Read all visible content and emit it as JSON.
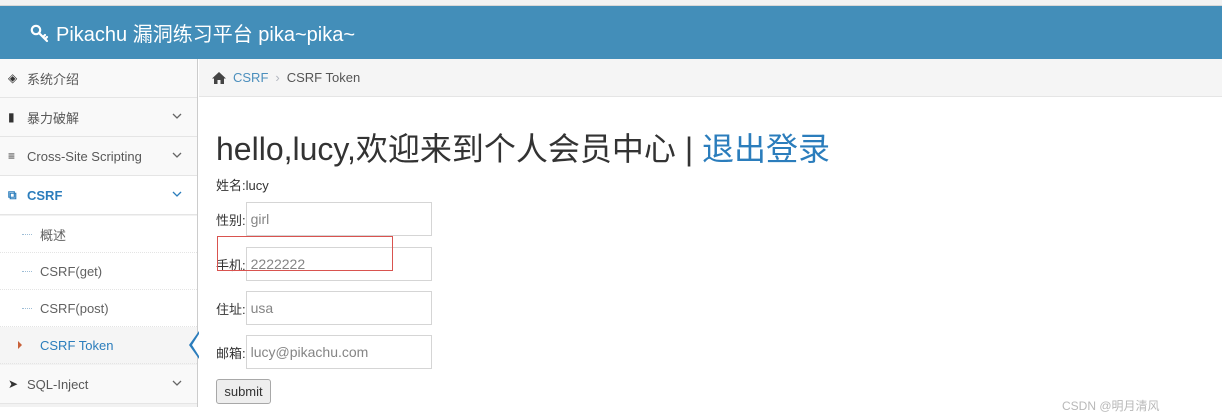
{
  "header": {
    "title": "Pikachu 漏洞练习平台 pika~pika~"
  },
  "sidebar": {
    "items": [
      {
        "label": "系统介绍",
        "icon": "tag-icon"
      },
      {
        "label": "暴力破解",
        "icon": "lock-icon"
      },
      {
        "label": "Cross-Site Scripting",
        "icon": "list-icon"
      },
      {
        "label": "CSRF",
        "icon": "share-icon"
      },
      {
        "label": "SQL-Inject",
        "icon": "plane-icon"
      }
    ],
    "csrf_sub": [
      "概述",
      "CSRF(get)",
      "CSRF(post)",
      "CSRF Token"
    ]
  },
  "breadcrumb": {
    "section": "CSRF",
    "current": "CSRF Token"
  },
  "main": {
    "greeting": "hello,lucy,欢迎来到个人会员中心",
    "divider": "|",
    "logout": "退出登录",
    "name_line": "姓名:lucy",
    "fields": [
      {
        "label": "性别:",
        "value": "girl"
      },
      {
        "label": "手机:",
        "value": "2222222"
      },
      {
        "label": "住址:",
        "value": "usa"
      },
      {
        "label": "邮箱:",
        "value": "lucy@pikachu.com"
      }
    ],
    "submit": "submit"
  },
  "watermark": "CSDN @明月清风",
  "colors": {
    "navbar": "#438eb9",
    "link": "#2b7dbc",
    "highlight_box": "#d9534f"
  }
}
